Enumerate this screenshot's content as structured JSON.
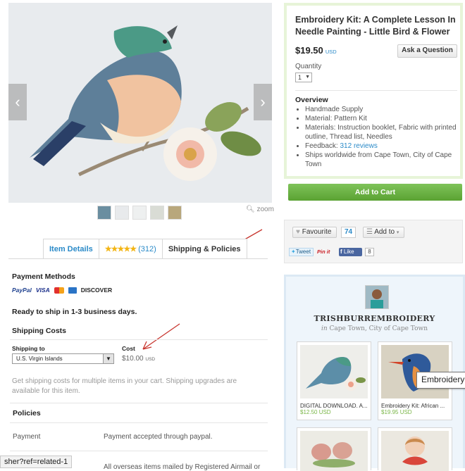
{
  "listing": {
    "title": "Embroidery Kit: A Complete Lesson In Needle Painting - Little Bird & Flower",
    "price": "$19.50",
    "currency": "USD",
    "ask_question": "Ask a Question",
    "quantity_label": "Quantity",
    "quantity_value": "1",
    "overview_title": "Overview",
    "overview": {
      "handmade": "Handmade Supply",
      "material": "Material: Pattern Kit",
      "materials": "Materials: Instruction booklet, Fabric with printed outline, Thread list, Needles",
      "feedback_prefix": "Feedback: ",
      "feedback_link": "312 reviews",
      "ships": "Ships worldwide from Cape Town, City of Cape Town"
    },
    "add_to_cart": "Add to Cart"
  },
  "gallery": {
    "zoom_label": "zoom",
    "prev": "‹",
    "next": "›"
  },
  "tabs": {
    "item_details": "Item Details",
    "stars": "★★★★★",
    "reviews_count": "(312)",
    "shipping": "Shipping & Policies"
  },
  "shipping": {
    "payment_methods_title": "Payment Methods",
    "payment_logos": {
      "paypal": "PayPal",
      "visa": "VISA",
      "discover": "DISCOVER"
    },
    "ready": "Ready to ship in 1-3 business days.",
    "costs_title": "Shipping Costs",
    "ship_to_label": "Shipping to",
    "ship_to_value": "U.S. Virgin Islands",
    "cost_label": "Cost",
    "cost_value": "$10.00",
    "cost_currency": "USD",
    "note": "Get shipping costs for multiple items in your cart. Shipping upgrades are available for this item.",
    "policies_title": "Policies",
    "payment_row_label": "Payment",
    "payment_row_value": "Payment accepted through paypal.",
    "partial_row_value": "All overseas items mailed by Registered Airmail or"
  },
  "social": {
    "favourite": "Favourite",
    "favourite_count": "74",
    "add_to": "Add to",
    "tweet": "Tweet",
    "pinit": "Pin it",
    "like": "Like",
    "like_count": "8"
  },
  "shop": {
    "name": "TRISHBURREMBROIDERY",
    "location_prefix": "in",
    "location": "Cape Town, City of Cape Town",
    "items": [
      {
        "title": "DIGITAL DOWNLOAD. A...",
        "price": "$12.50 USD"
      },
      {
        "title": "Embroidery Kit: African ...",
        "price": "$19.95 USD"
      }
    ]
  },
  "overlays": {
    "status_url": "sher?ref=related-1",
    "tooltip": "Embroidery"
  },
  "colors": {
    "link": "#2a8ac8",
    "price_green": "#7ab648",
    "cart_green": "#5aa232",
    "annotation_red": "#c8352e"
  }
}
